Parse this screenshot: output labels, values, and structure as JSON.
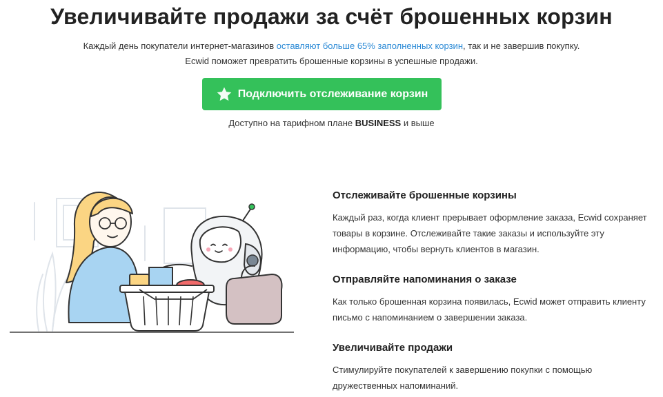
{
  "header": {
    "title": "Увеличивайте продажи за счёт брошенных корзин"
  },
  "intro": {
    "line1_before": "Каждый день покупатели интернет-магазинов ",
    "line1_link": "оставляют больше 65% заполненных корзин",
    "line1_after": ", так и не завершив покупку.",
    "line2": "Ecwid поможет превратить брошенные корзины в успешные продажи."
  },
  "cta": {
    "icon": "star-icon",
    "label": "Подключить отслеживание корзин",
    "color": "#34c15a"
  },
  "plan": {
    "before": "Доступно на тарифном плане ",
    "plan_name": "BUSINESS",
    "after": " и выше"
  },
  "illustration": {
    "icon": "shopper-robot-cart-illustration"
  },
  "features": [
    {
      "title": "Отслеживайте брошенные корзины",
      "text": "Каждый раз, когда клиент прерывает оформление заказа, Ecwid сохраняет товары в корзине. Отслеживайте такие заказы и используйте эту информацию, чтобы вернуть клиентов в магазин."
    },
    {
      "title": "Отправляйте напоминания о заказе",
      "text": "Как только брошенная корзина появилась, Ecwid может отправить клиенту письмо с напоминанием о завершении заказа."
    },
    {
      "title": "Увеличивайте продажи",
      "text": "Стимулируйте покупателей к завершению покупки с помощью дружественных напоминаний."
    }
  ],
  "colors": {
    "link": "#2b8ad6",
    "button": "#34c15a",
    "text": "#333333",
    "heading": "#222222"
  }
}
